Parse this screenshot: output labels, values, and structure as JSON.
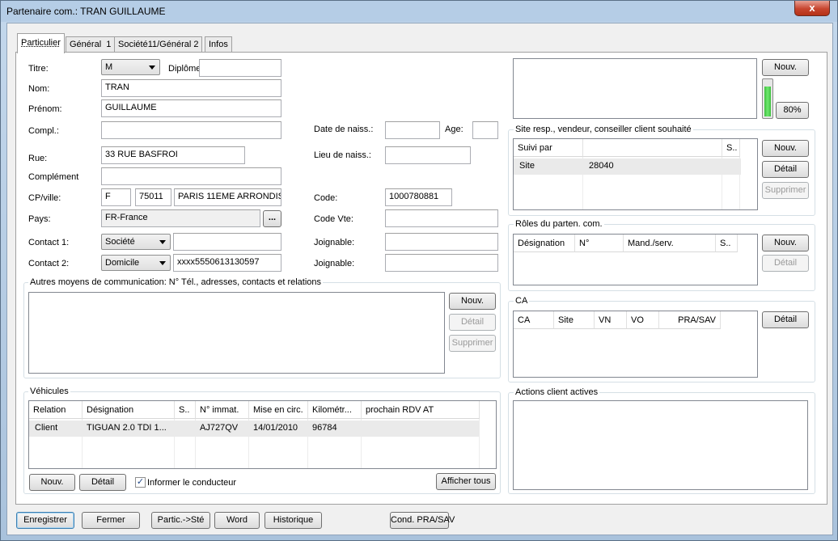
{
  "window": {
    "title": "Partenaire com.: TRAN GUILLAUME",
    "close_glyph": "x"
  },
  "tabs": [
    {
      "label": "Particulier",
      "active": true
    },
    {
      "label": "Général  1"
    },
    {
      "label": "Société11/Général 2"
    },
    {
      "label": "Infos"
    }
  ],
  "form": {
    "titre_label": "Titre:",
    "titre_value": "M",
    "diplome_label": "Diplôme",
    "diplome_value": "",
    "nom_label": "Nom:",
    "nom_value": "TRAN",
    "prenom_label": "Prénom:",
    "prenom_value": "GUILLAUME",
    "compl_label": "Compl.:",
    "compl_value": "",
    "date_naiss_label": "Date de naiss.:",
    "date_naiss_value": "",
    "age_label": "Age:",
    "age_value": "",
    "rue_label": "Rue:",
    "rue_value": "33 RUE BASFROI",
    "lieu_naiss_label": "Lieu de naiss.:",
    "lieu_naiss_value": "",
    "complement_label": "Complément",
    "complement_value": "",
    "cpville_label": "CP/ville:",
    "cp_prefix": "F",
    "cp_value": "75011",
    "ville_value": "PARIS 11EME ARRONDISS",
    "code_label": "Code:",
    "code_value": "1000780881",
    "pays_label": "Pays:",
    "pays_value": "FR-France",
    "pays_browse": "...",
    "code_vte_label": "Code Vte:",
    "code_vte_value": "",
    "contact1_label": "Contact 1:",
    "contact1_type": "Société",
    "contact1_value": "",
    "joignable1_label": "Joignable:",
    "joignable1_value": "",
    "contact2_label": "Contact 2:",
    "contact2_type": "Domicile",
    "contact2_value": "xxxx5550613130597",
    "joignable2_label": "Joignable:",
    "joignable2_value": ""
  },
  "comm": {
    "title": "Autres moyens de communication: N° Tél., adresses, contacts et relations",
    "nouv": "Nouv.",
    "detail": "Détail",
    "supprimer": "Supprimer"
  },
  "vehicules": {
    "title": "Véhicules",
    "columns": [
      "Relation",
      "Désignation",
      "S..",
      "N° immat.",
      "Mise en circ.",
      "Kilométr...",
      "prochain RDV AT"
    ],
    "rows": [
      [
        "Client",
        "TIGUAN 2.0 TDI 1...",
        "",
        "AJ727QV",
        "14/01/2010",
        "96784",
        ""
      ]
    ],
    "nouv": "Nouv.",
    "detail": "Détail",
    "informer_label": "Informer le conducteur",
    "informer_checked": true,
    "afficher_tous": "Afficher tous"
  },
  "right_top": {
    "nouv": "Nouv.",
    "progress_label": "80%",
    "progress": 0.8
  },
  "site_resp": {
    "title": "Site resp., vendeur, conseiller client souhaité",
    "columns": [
      "Suivi par",
      "",
      "S.."
    ],
    "rows": [
      [
        "Site",
        "28040",
        ""
      ]
    ],
    "nouv": "Nouv.",
    "detail": "Détail",
    "supprimer": "Supprimer"
  },
  "roles": {
    "title": "Rôles du parten. com.",
    "columns": [
      "Désignation",
      "N°",
      "Mand./serv.",
      "S.."
    ],
    "nouv": "Nouv.",
    "detail": "Détail"
  },
  "ca": {
    "title": "CA",
    "columns": [
      "CA",
      "Site",
      "VN",
      "VO",
      "PRA/SAV"
    ],
    "detail": "Détail"
  },
  "actions": {
    "title": "Actions client actives"
  },
  "footer": {
    "enregistrer": "Enregistrer",
    "fermer": "Fermer",
    "partic_ste": "Partic.->Sté",
    "word": "Word",
    "historique": "Historique",
    "cond_pra": "Cond. PRA/SAV"
  },
  "colors": {
    "progress_green": "#3fbf3f",
    "selection_row": "#eaeaea",
    "title_bg": "#b5cde6"
  }
}
